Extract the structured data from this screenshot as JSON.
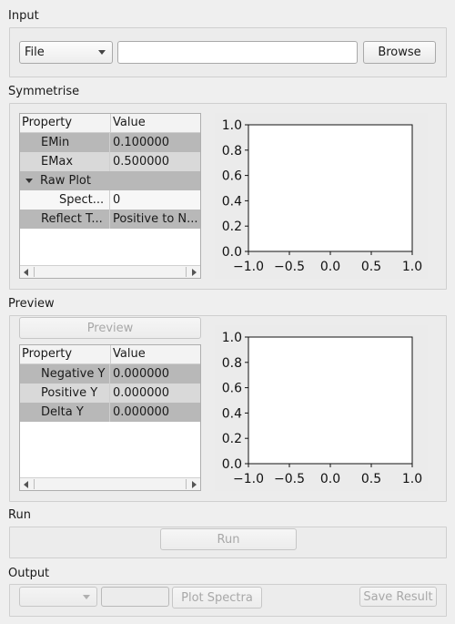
{
  "input": {
    "title": "Input",
    "type_select": "File",
    "path_value": "",
    "browse_label": "Browse"
  },
  "symmetrise": {
    "title": "Symmetrise",
    "headers": [
      "Property",
      "Value"
    ],
    "rows": [
      {
        "name": "EMin",
        "value": "0.100000"
      },
      {
        "name": "EMax",
        "value": "0.500000"
      },
      {
        "name": "Raw Plot",
        "value": ""
      },
      {
        "name": "Spect...",
        "value": "0"
      },
      {
        "name": "Reflect T...",
        "value": "Positive to N..."
      }
    ],
    "plot": {
      "x_ticks": [
        "−1.0",
        "−0.5",
        "0.0",
        "0.5",
        "1.0"
      ],
      "y_ticks": [
        "0.0",
        "0.2",
        "0.4",
        "0.6",
        "0.8",
        "1.0"
      ]
    }
  },
  "preview": {
    "title": "Preview",
    "button_label": "Preview",
    "headers": [
      "Property",
      "Value"
    ],
    "rows": [
      {
        "name": "Negative Y",
        "value": "0.000000"
      },
      {
        "name": "Positive Y",
        "value": "0.000000"
      },
      {
        "name": "Delta Y",
        "value": "0.000000"
      }
    ],
    "plot": {
      "x_ticks": [
        "−1.0",
        "−0.5",
        "0.0",
        "0.5",
        "1.0"
      ],
      "y_ticks": [
        "0.0",
        "0.2",
        "0.4",
        "0.6",
        "0.8",
        "1.0"
      ]
    }
  },
  "run": {
    "title": "Run",
    "button_label": "Run"
  },
  "output": {
    "title": "Output",
    "select_value": "",
    "field_value": "",
    "plot_spectra_label": "Plot Spectra",
    "save_result_label": "Save Result"
  }
}
